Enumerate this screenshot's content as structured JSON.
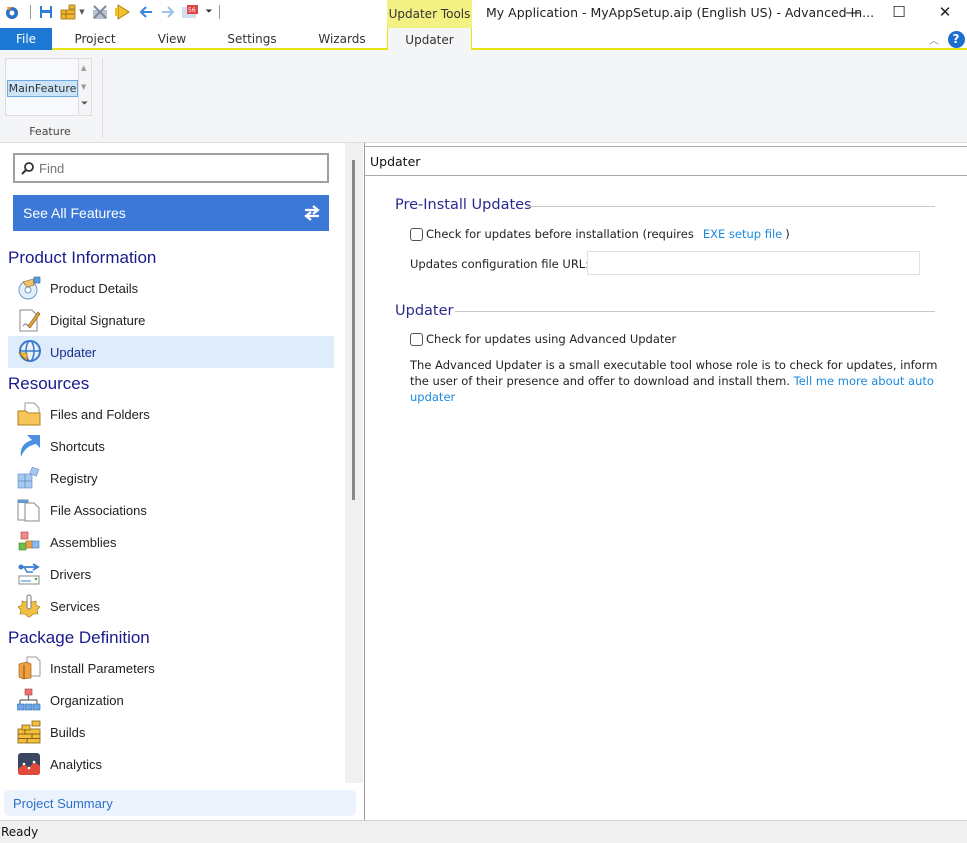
{
  "window": {
    "title": "My Application - MyAppSetup.aip (English US) - Advanced In...",
    "context_tool_label": "Updater Tools",
    "controls": {
      "minimize": "—",
      "maximize": "☐",
      "close": "✕"
    }
  },
  "quick_access": {
    "icons": [
      "app-logo-icon",
      "save-icon",
      "build-icon",
      "build-options-icon",
      "clean-icon",
      "run-icon",
      "back-icon",
      "forward-icon",
      "calendar-icon",
      "customize-qat-icon"
    ],
    "calendar_badge": "56"
  },
  "ribbon": {
    "tabs": [
      {
        "label": "File"
      },
      {
        "label": "Project"
      },
      {
        "label": "View"
      },
      {
        "label": "Settings"
      },
      {
        "label": "Wizards"
      },
      {
        "label": "Updater",
        "active": true
      }
    ],
    "gallery_item": "MainFeature",
    "group_label": "Feature",
    "help_label": "?"
  },
  "left_panel": {
    "search_placeholder": "Find",
    "see_all_label": "See All Features",
    "sections": [
      {
        "title": "Product Information",
        "items": [
          {
            "label": "Product Details",
            "icon": "product-details-icon"
          },
          {
            "label": "Digital Signature",
            "icon": "digital-signature-icon"
          },
          {
            "label": "Updater",
            "icon": "updater-icon",
            "selected": true
          }
        ]
      },
      {
        "title": "Resources",
        "items": [
          {
            "label": "Files and Folders",
            "icon": "files-folders-icon"
          },
          {
            "label": "Shortcuts",
            "icon": "shortcuts-icon"
          },
          {
            "label": "Registry",
            "icon": "registry-icon"
          },
          {
            "label": "File Associations",
            "icon": "file-associations-icon"
          },
          {
            "label": "Assemblies",
            "icon": "assemblies-icon"
          },
          {
            "label": "Drivers",
            "icon": "drivers-icon"
          },
          {
            "label": "Services",
            "icon": "services-icon"
          }
        ]
      },
      {
        "title": "Package Definition",
        "items": [
          {
            "label": "Install Parameters",
            "icon": "install-parameters-icon"
          },
          {
            "label": "Organization",
            "icon": "organization-icon"
          },
          {
            "label": "Builds",
            "icon": "builds-icon"
          },
          {
            "label": "Analytics",
            "icon": "analytics-icon"
          }
        ]
      }
    ],
    "project_summary": "Project Summary"
  },
  "main": {
    "header": "Updater",
    "pre_install": {
      "title": "Pre-Install Updates",
      "checkbox_label": "Check for updates before installation (requires",
      "checkbox_checked": false,
      "link": "EXE setup file",
      "after_link": ")",
      "url_label": "Updates configuration file URL:",
      "url_value": ""
    },
    "updater": {
      "title": "Updater",
      "checkbox_label": "Check for updates using Advanced Updater",
      "checkbox_checked": false,
      "description": "The Advanced Updater is a small executable tool whose role is to check for updates, inform the user of their presence and offer to download and install them.",
      "link": "Tell me more about auto updater"
    }
  },
  "status_bar": {
    "text": "Ready"
  },
  "colors": {
    "accent_blue": "#3c78d8",
    "file_tab": "#1c78d3",
    "context_yellow": "#f4f184",
    "section_title": "#1a1a8c",
    "link": "#1a8ae0",
    "selected_bg": "#dfecfb"
  }
}
